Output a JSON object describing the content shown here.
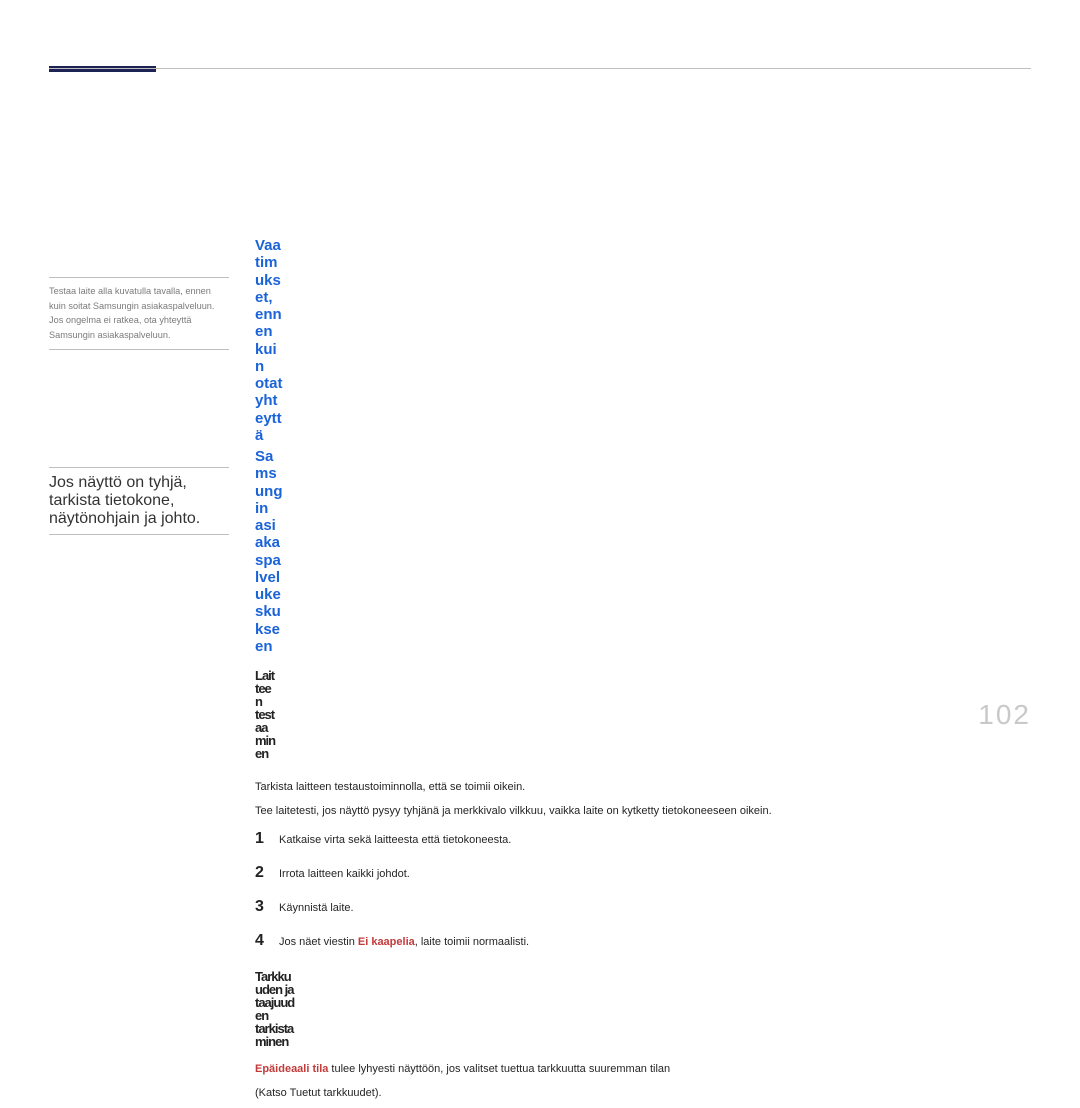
{
  "page_number": "102",
  "sidebar_note_1": "Testaa laite alla kuvatulla tavalla, ennen kuin soitat Samsungin asiakaspalveluun. Jos ongelma ei ratkea, ota yhteyttä Samsungin asiakaspalveluun.",
  "sidebar_note_2": "Jos näyttö on tyhjä, tarkista tietokone, näytönohjain ja johto.",
  "heading_blue_l1": "Vaatimukset, ennen kuin otat yhteyttä",
  "heading_blue_l2": "Samsungin asiakaspalvelukeskukseen",
  "heading_testing": "Laitteen testaaminen",
  "intro_p1": "Tarkista laitteen testaustoiminnolla, että se toimii oikein.",
  "intro_p2": "Tee laitetesti, jos näyttö pysyy tyhjänä ja merkkivalo vilkkuu, vaikka laite on kytketty tietokoneeseen oikein.",
  "steps": {
    "1": "Katkaise virta sekä laitteesta että tietokoneesta.",
    "2": "Irrota laitteen kaikki johdot.",
    "3": "Käynnistä laite.",
    "4_pre": "Jos näet viestin ",
    "4_red": "Ei kaapelia",
    "4_post": ", laite toimii normaalisti."
  },
  "heading_resolution": "Tarkkuuden ja taajuuden tarkistaminen",
  "res_p1_red": "Epäideaali tila",
  "res_p1_rest": " tulee lyhyesti näyttöön, jos valitset tuettua tarkkuutta suuremman tilan",
  "res_p2": "(Katso Tuetut tarkkuudet)."
}
